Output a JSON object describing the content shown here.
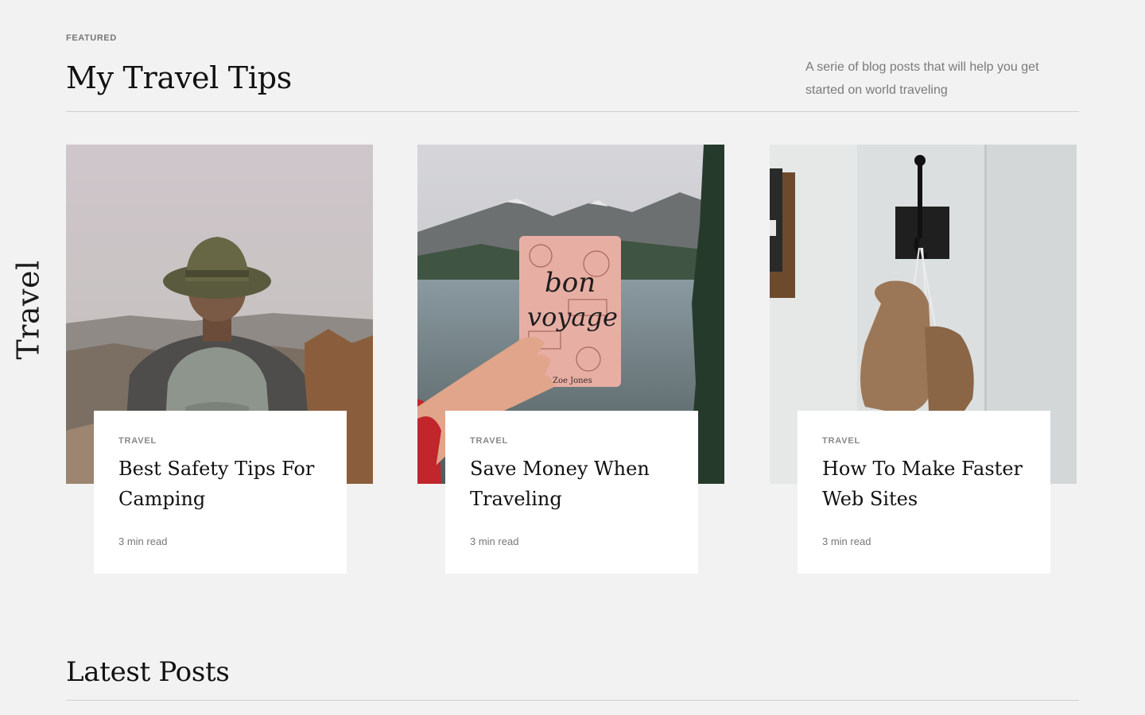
{
  "side_label": "Travel",
  "featured": {
    "eyebrow": "FEATURED",
    "title": "My Travel Tips",
    "description": "A serie of blog posts that will help you get started on world traveling"
  },
  "cards": [
    {
      "category": "TRAVEL",
      "title": "Best Safety Tips For Camping",
      "meta": "3 min read",
      "image_icon": "hiker-with-hat-photo"
    },
    {
      "category": "TRAVEL",
      "title": "Save Money When Traveling",
      "meta": "3 min read",
      "image_icon": "passport-bon-voyage-photo",
      "image_text": {
        "line1": "bon",
        "line2": "voyage",
        "signature": "Zoe Jones"
      }
    },
    {
      "category": "TRAVEL",
      "title": "How To Make Faster Web Sites",
      "meta": "3 min read",
      "image_icon": "boxing-gloves-on-hook-photo"
    }
  ],
  "latest": {
    "title": "Latest Posts"
  },
  "colors": {
    "background": "#f2f2f2",
    "card": "#ffffff",
    "text": "#111111",
    "muted": "#7a7a7a",
    "divider": "#cfcfcf"
  }
}
